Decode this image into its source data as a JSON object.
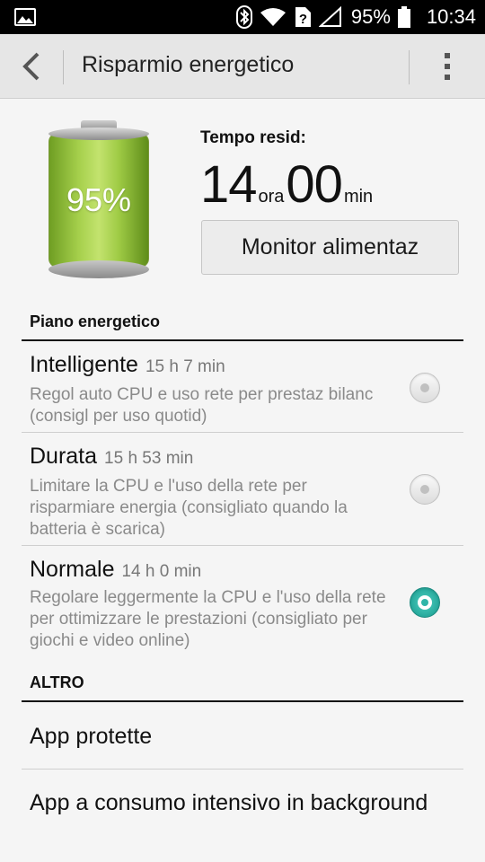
{
  "status_bar": {
    "battery_percent": "95%",
    "time": "10:34",
    "icons": [
      "gallery-icon",
      "bluetooth-icon",
      "wifi-icon",
      "sim-unknown-icon",
      "signal-icon",
      "battery-icon"
    ]
  },
  "toolbar": {
    "title": "Risparmio energetico"
  },
  "battery": {
    "percent_label": "95%",
    "level": 0.95,
    "color": "#9fcb45"
  },
  "remaining": {
    "label": "Tempo resid:",
    "hours": "14",
    "hours_unit": "ora",
    "minutes": "00",
    "minutes_unit": "min"
  },
  "monitor_button": "Monitor alimentaz",
  "plan_section": {
    "header": "Piano energetico",
    "options": [
      {
        "name": "Intelligente",
        "time": "15 h 7 min",
        "description": "Regol auto CPU e uso rete per prestaz bilanc (consigl per uso quotid)",
        "selected": false
      },
      {
        "name": "Durata",
        "time": "15 h 53 min",
        "description": "Limitare la CPU e l'uso della rete per risparmiare energia (consigliato quando la batteria è scarica)",
        "selected": false
      },
      {
        "name": "Normale",
        "time": "14 h 0 min",
        "description": "Regolare leggermente la CPU e l'uso della rete per ottimizzare le prestazioni (consigliato per giochi e video online)",
        "selected": true
      }
    ]
  },
  "other_section": {
    "header": "ALTRO",
    "items": [
      "App protette",
      "App a consumo intensivo in background"
    ]
  },
  "colors": {
    "accent": "#27a99c",
    "toolbar_bg": "#e6e6e6",
    "page_bg": "#f5f5f5"
  }
}
